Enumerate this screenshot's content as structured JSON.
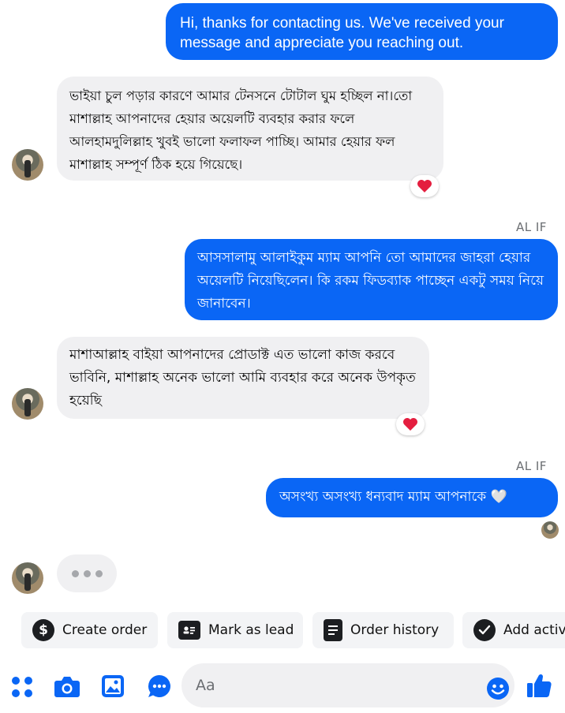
{
  "messages": [
    {
      "side": "out",
      "text": "Hi, thanks for contacting us. We've received your message and appreciate you reaching out."
    },
    {
      "side": "in",
      "text": "ভাইয়া চুল পড়ার কারণে আমার টেনসনে টোটাল ঘুম হচ্ছিল না।তো মাশাল্লাহ আপনাদের হেয়ার অয়েলটি ব্যবহার করার ফলে আলহামদুলিল্লাহ খুবই ভালো ফলাফল পাচ্ছি। আমার হেয়ার ফল মাশাল্লাহ সম্পূর্ণ ঠিক হয়ে গিয়েছে।",
      "reaction": "heart"
    },
    {
      "side": "sender_label",
      "text": "AL IF"
    },
    {
      "side": "out",
      "text": "আসসালামু আলাইকুম ম্যাম আপনি তো আমাদের জাহরা হেয়ার অয়েলটি নিয়েছিলেন। কি রকম ফিডব্যাক পাচ্ছেন একটু সময় নিয়ে জানাবেন।"
    },
    {
      "side": "in",
      "text": "মাশাআল্লাহ  বাইয়া আপনাদের  প্রোডাক্ট এত ভালো কাজ করবে ভাবিনি, মাশাল্লাহ অনেক ভালো আমি ব্যবহার করে অনেক উপকৃত হয়েছি",
      "reaction": "heart"
    },
    {
      "side": "sender_label",
      "text": "AL IF"
    },
    {
      "side": "out",
      "text": "অসংখ্য অসংখ্য ধন্যবাদ ম্যাম আপনাকে 🤍"
    }
  ],
  "quick_actions": [
    {
      "label": "Create order",
      "icon": "dollar-icon"
    },
    {
      "label": "Mark as lead",
      "icon": "id-card-icon"
    },
    {
      "label": "Order history",
      "icon": "list-doc-icon"
    },
    {
      "label": "Add activ",
      "icon": "check-circle-icon"
    }
  ],
  "composer": {
    "placeholder": "Aa"
  },
  "colors": {
    "accent": "#0a66f5",
    "heart": "#e41e3f"
  }
}
